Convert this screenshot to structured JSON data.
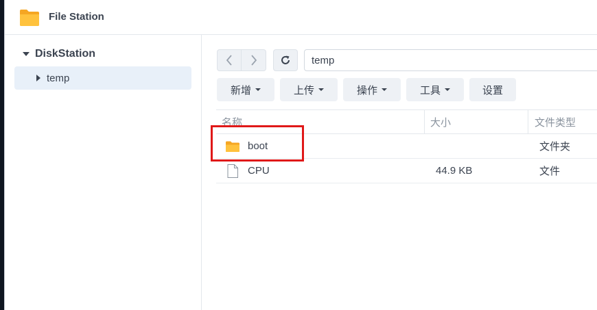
{
  "window": {
    "title": "File Station",
    "app_icon": "folder-icon"
  },
  "sidebar": {
    "root_label": "DiskStation",
    "items": [
      {
        "label": "temp",
        "selected": true
      }
    ]
  },
  "toolbar": {
    "path_value": "temp",
    "buttons": [
      {
        "label": "新增",
        "has_dropdown": true
      },
      {
        "label": "上传",
        "has_dropdown": true
      },
      {
        "label": "操作",
        "has_dropdown": true
      },
      {
        "label": "工具",
        "has_dropdown": true
      },
      {
        "label": "设置",
        "has_dropdown": false
      }
    ]
  },
  "file_list": {
    "columns": [
      "名称",
      "大小",
      "文件类型"
    ],
    "rows": [
      {
        "name": "boot",
        "size": "",
        "type": "文件夹",
        "icon": "folder-icon"
      },
      {
        "name": "CPU",
        "size": "44.9 KB",
        "type": "文件",
        "icon": "file-icon"
      }
    ]
  },
  "colors": {
    "accent_highlight": "#e01818",
    "folder": "#f5a623",
    "selection": "#e8f0f9"
  }
}
